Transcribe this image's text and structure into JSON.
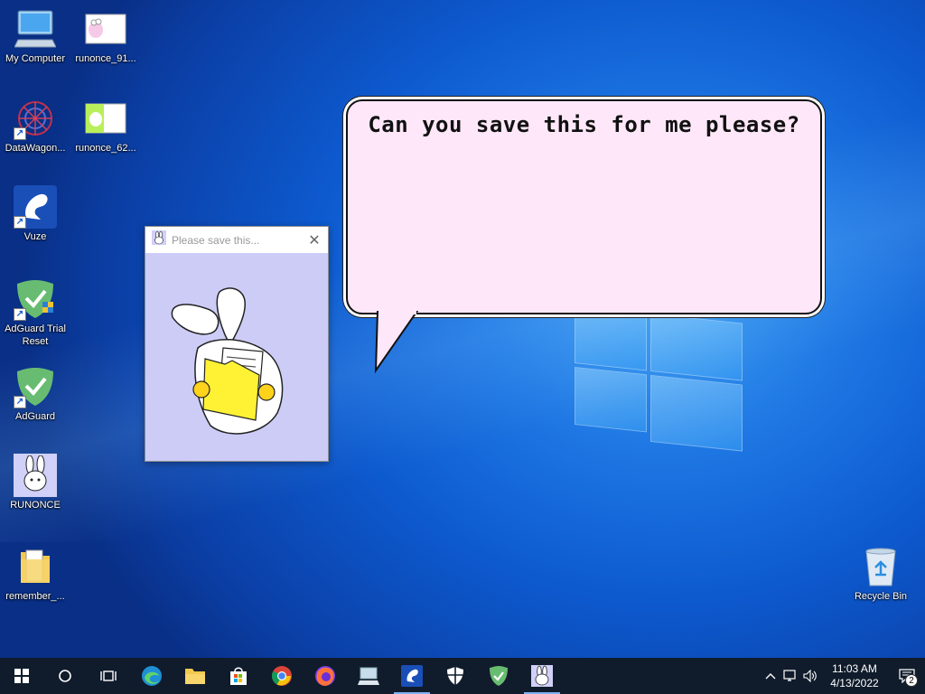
{
  "desktop": {
    "icons": [
      {
        "label": "My Computer",
        "icon": "computer-icon"
      },
      {
        "label": "runonce_91...",
        "icon": "image-file-icon"
      },
      {
        "label": "DataWagon...",
        "icon": "datawagon-icon"
      },
      {
        "label": "runonce_62...",
        "icon": "image-file-icon"
      },
      {
        "label": "Vuze",
        "icon": "vuze-icon"
      },
      {
        "label": "AdGuard Trial Reset",
        "icon": "adguard-icon"
      },
      {
        "label": "AdGuard",
        "icon": "adguard-icon"
      },
      {
        "label": "RUNONCE",
        "icon": "bunny-icon"
      },
      {
        "label": "remember_...",
        "icon": "folder-icon"
      },
      {
        "label": "Recycle Bin",
        "icon": "recycle-bin-icon"
      }
    ]
  },
  "bubble": {
    "text": "Can you save this for me please?"
  },
  "popup": {
    "title": "Please save this...",
    "close": "✕"
  },
  "taskbar": {
    "apps": [
      "start",
      "search",
      "task-view",
      "edge",
      "file-explorer",
      "store",
      "chrome",
      "firefox",
      "computer",
      "vuze",
      "security",
      "adguard",
      "runonce"
    ],
    "clock_time": "11:03 AM",
    "clock_date": "4/13/2022",
    "notification_count": "2"
  },
  "colors": {
    "bubble_fill": "#fde7f8",
    "popup_bg": "#ccccf7",
    "taskbar": "#101c2c"
  }
}
